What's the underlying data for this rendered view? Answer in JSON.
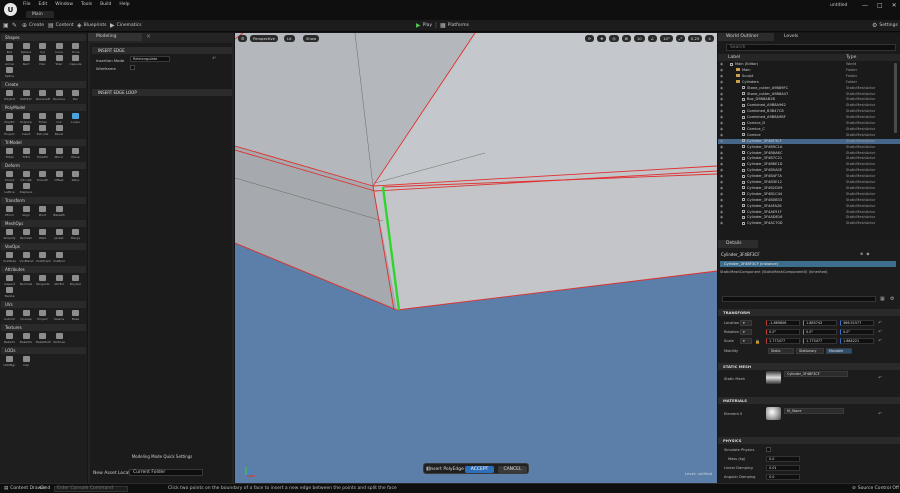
{
  "app": {
    "name": "untitled",
    "logo": "U",
    "menu": [
      "File",
      "Edit",
      "Window",
      "Tools",
      "Build",
      "Help"
    ],
    "project_tab": "Main",
    "window_controls": {
      "minimize": "—",
      "maximize": "□",
      "close": "✕"
    }
  },
  "toolbar": {
    "create": "Create",
    "content": "Content",
    "blueprints": "Blueprints",
    "cinematics": "Cinematics",
    "play": "Play",
    "platforms": "Platforms",
    "settings": "Settings"
  },
  "toolbox": {
    "categories": [
      {
        "name": "Shapes",
        "tools": [
          "Box",
          "Sphere",
          "Cyl",
          "Cone",
          "Torus",
          "Arrow",
          "Rect",
          "Disc",
          "Stair",
          "Capsule",
          "Spline"
        ]
      },
      {
        "name": "Create",
        "tools": [
          "PolyExt",
          "PathExt",
          "RevolveB",
          "Revolve",
          "Pen"
        ]
      },
      {
        "name": "PolyModel",
        "tools": [
          "PolyEd",
          "PolyGrp",
          "TriSel",
          "Cut",
          "Loops",
          "Project",
          "Insert",
          "Extrude",
          "Bevel"
        ]
      },
      {
        "name": "TriModel",
        "tools": [
          "TriSel",
          "TriEd",
          "HoleFill",
          "Mirror",
          "Plane"
        ]
      },
      {
        "name": "Deform",
        "tools": [
          "Sculpt",
          "VSculpt",
          "Smooth",
          "Offset",
          "Warp",
          "Lattice",
          "Displace"
        ]
      },
      {
        "name": "Transform",
        "tools": [
          "XForm",
          "Align",
          "Pivot",
          "BakeRS"
        ]
      },
      {
        "name": "MeshOps",
        "tools": [
          "Simplify",
          "Remesh",
          "Weld",
          "Jacket",
          "Merge"
        ]
      },
      {
        "name": "VoxOps",
        "tools": [
          "VoxWrap",
          "VoxBlend",
          "VoxMorph",
          "VoxBool"
        ]
      },
      {
        "name": "Attributes",
        "tools": [
          "Inspect",
          "Normals",
          "Tangents",
          "AttrEd",
          "PolyGrp",
          "Nanite"
        ]
      },
      {
        "name": "UVs",
        "tools": [
          "AutoUV",
          "Unwrap",
          "Project",
          "Seams",
          "Bake"
        ]
      },
      {
        "name": "Textures",
        "tools": [
          "BakeTx",
          "BakeVtx",
          "BakeMulti",
          "Vertices"
        ]
      },
      {
        "name": "LODs",
        "tools": [
          "LODMgr",
          "Cap"
        ]
      }
    ]
  },
  "modeling": {
    "tab": "Modeling",
    "section_title": "INSERT EDGE",
    "insertion_mode_label": "Insertion Mode",
    "insertion_mode_value": "Retriangulate",
    "wireframe_label": "Wireframe",
    "section2_title": "INSERT EDGE LOOP",
    "quick_settings": "Modeling Mode Quick Settings",
    "asset_location_label": "New Asset Location",
    "asset_location_value": "Current Folder"
  },
  "viewport": {
    "view_mode": "Perspective",
    "lit": "Lit",
    "show": "Show",
    "right_tools": [
      "⟳",
      "✥",
      "◎",
      "⊞",
      "10",
      "∠",
      "10°",
      "⤢",
      "0.25",
      "4"
    ],
    "accept_label": "Insert PolyEdge",
    "accept_button": "ACCEPT",
    "cancel_button": "CANCEL",
    "level_label": "Level: untitled"
  },
  "outliner": {
    "tab": "World Outliner",
    "tab2": "Levels",
    "search_placeholder": "Search",
    "col_label": "Label",
    "col_type": "Type",
    "rows": [
      {
        "name": "Main (Editor)",
        "type": "World",
        "indent": 0,
        "icon": "world"
      },
      {
        "name": "Main",
        "type": "Folder",
        "indent": 1,
        "icon": "folder"
      },
      {
        "name": "Sculpt",
        "type": "Folder",
        "indent": 1,
        "icon": "folder"
      },
      {
        "name": "Cylinders",
        "type": "Folder",
        "indent": 1,
        "icon": "folder"
      },
      {
        "name": "Stone_cutter_A9B89FC",
        "type": "StaticMeshActor",
        "indent": 2,
        "icon": "mesh"
      },
      {
        "name": "Stone_cutter_A9B8A47",
        "type": "StaticMeshActor",
        "indent": 2,
        "icon": "mesh"
      },
      {
        "name": "Box_D9B8AB2B",
        "type": "StaticMeshActor",
        "indent": 2,
        "icon": "mesh"
      },
      {
        "name": "Combined_A9B8A962",
        "type": "StaticMeshActor",
        "indent": 2,
        "icon": "mesh"
      },
      {
        "name": "Combined_B3B47C8",
        "type": "StaticMeshActor",
        "indent": 2,
        "icon": "mesh"
      },
      {
        "name": "Combined_A9B8A9BF",
        "type": "StaticMeshActor",
        "indent": 2,
        "icon": "mesh"
      },
      {
        "name": "Cornice_D",
        "type": "StaticMeshActor",
        "indent": 2,
        "icon": "mesh"
      },
      {
        "name": "Cornice_C",
        "type": "StaticMeshActor",
        "indent": 2,
        "icon": "mesh"
      },
      {
        "name": "Cornice",
        "type": "StaticMeshActor",
        "indent": 2,
        "icon": "mesh"
      },
      {
        "name": "Cylinder_3F4BF3CF",
        "type": "StaticMeshActor",
        "indent": 2,
        "icon": "mesh",
        "selected": true
      },
      {
        "name": "Cylinder_3F4B9C1A",
        "type": "StaticMeshActor",
        "indent": 2,
        "icon": "mesh"
      },
      {
        "name": "Cylinder_3F4B8A6C",
        "type": "StaticMeshActor",
        "indent": 2,
        "icon": "mesh"
      },
      {
        "name": "Cylinder_3F4B7C21",
        "type": "StaticMeshActor",
        "indent": 2,
        "icon": "mesh"
      },
      {
        "name": "Cylinder_3F4B6E1D",
        "type": "StaticMeshActor",
        "indent": 2,
        "icon": "mesh"
      },
      {
        "name": "Cylinder_3F4B5A0E",
        "type": "StaticMeshActor",
        "indent": 2,
        "icon": "mesh"
      },
      {
        "name": "Cylinder_3F4B4F7A",
        "type": "StaticMeshActor",
        "indent": 2,
        "icon": "mesh"
      },
      {
        "name": "Cylinder_3F4B3E12",
        "type": "StaticMeshActor",
        "indent": 2,
        "icon": "mesh"
      },
      {
        "name": "Cylinder_3F4B2D09",
        "type": "StaticMeshActor",
        "indent": 2,
        "icon": "mesh"
      },
      {
        "name": "Cylinder_3F4B1C44",
        "type": "StaticMeshActor",
        "indent": 2,
        "icon": "mesh"
      },
      {
        "name": "Cylinder_3F4B0B33",
        "type": "StaticMeshActor",
        "indent": 2,
        "icon": "mesh"
      },
      {
        "name": "Cylinder_3F4AFA28",
        "type": "StaticMeshActor",
        "indent": 2,
        "icon": "mesh"
      },
      {
        "name": "Cylinder_3F4AE91F",
        "type": "StaticMeshActor",
        "indent": 2,
        "icon": "mesh"
      },
      {
        "name": "Cylinder_3F4AD816",
        "type": "StaticMeshActor",
        "indent": 2,
        "icon": "mesh"
      },
      {
        "name": "Cylinder_3F4AC70D",
        "type": "StaticMeshActor",
        "indent": 2,
        "icon": "mesh"
      }
    ],
    "actor_count": "55 actors (1 selected)"
  },
  "details": {
    "tab": "Details",
    "selected_name": "Cylinder_3F4BF3CF",
    "instance_label": "Cylinder_3F4BF3CF (Instance)",
    "component_label": "StaticMeshComponent (StaticMeshComponent0) (Inherited)",
    "transform_header": "TRANSFORM",
    "location_label": "Location",
    "rotation_label": "Rotation",
    "scale_label": "Scale",
    "location": [
      "-1.869806",
      "1.883743",
      "366.51577"
    ],
    "rotation": [
      "0.0°",
      "0.0°",
      "0.0°"
    ],
    "scale": [
      "1.773477",
      "1.773477",
      "1.884221"
    ],
    "mobility_label": "Mobility",
    "mobility": [
      "Static",
      "Stationary",
      "Movable"
    ],
    "static_mesh_header": "STATIC MESH",
    "static_mesh_label": "Static Mesh",
    "static_mesh_value": "Cylinder_3F4BF3CF",
    "materials_header": "MATERIALS",
    "element0_label": "Element 0",
    "element0_value": "M_Stone",
    "physics_header": "PHYSICS",
    "simulate_label": "Simulate Physics",
    "mass_label": "Mass (kg)",
    "mass_value": "0.0",
    "linear_damping_label": "Linear Damping",
    "linear_damping_value": "0.01",
    "angular_damping_label": "Angular Damping",
    "angular_damping_value": "0.0"
  },
  "statusbar": {
    "content_drawer": "Content Drawer",
    "cmd": "Cmd",
    "cmd_placeholder": "Enter Console Command",
    "hint": "Click two points on the boundary of a face to insert a new edge between the points and split the face",
    "source_control": "Source Control Off"
  },
  "colors": {
    "accent_blue": "#2e6fba",
    "edge_red": "#e03030",
    "inserted_edge_green": "#2fd52f",
    "play_green": "#57c24c"
  }
}
